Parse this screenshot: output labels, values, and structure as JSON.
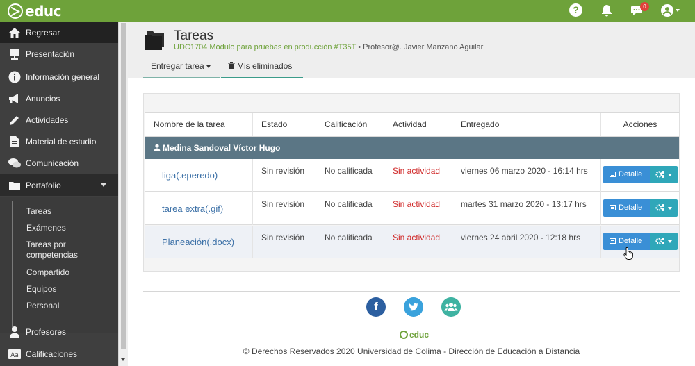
{
  "app": {
    "logo_text": "educ"
  },
  "topbar": {
    "help_label": "?",
    "notification_count": "0"
  },
  "sidebar": {
    "items": [
      {
        "label": "Regresar",
        "icon": "home-icon"
      },
      {
        "label": "Presentación",
        "icon": "presentation-icon"
      },
      {
        "label": "Información general",
        "icon": "info-icon"
      },
      {
        "label": "Anuncios",
        "icon": "megaphone-icon"
      },
      {
        "label": "Actividades",
        "icon": "pencil-icon"
      },
      {
        "label": "Material de estudio",
        "icon": "document-icon"
      },
      {
        "label": "Comunicación",
        "icon": "chat-icon"
      },
      {
        "label": "Portafolio",
        "icon": "folder-icon"
      },
      {
        "label": "Profesores",
        "icon": "user-icon"
      },
      {
        "label": "Calificaciones",
        "icon": "grades-icon"
      }
    ],
    "submenu": [
      "Tareas",
      "Exámenes",
      "Tareas por competencias",
      "Compartido",
      "Equipos",
      "Personal"
    ],
    "submenu_line2": "competencias"
  },
  "page": {
    "title": "Tareas",
    "course": "UDC1704 Módulo para pruebas en producción #T35T",
    "teacher": " • Profesor@. Javier Manzano Aguilar",
    "tabs": [
      "Entregar tarea",
      "Mis eliminados"
    ]
  },
  "table": {
    "headers": [
      "Nombre de la tarea",
      "Estado",
      "Calificación",
      "Actividad",
      "Entregado",
      "Acciones"
    ],
    "group": "Medina Sandoval Víctor Hugo",
    "rows": [
      {
        "name": "liga(.eperedo)",
        "estado": "Sin revisión",
        "calificacion": "No calificada",
        "actividad": "Sin actividad",
        "entregado": "viernes 06 marzo 2020 - 16:14 hrs"
      },
      {
        "name": "tarea extra(.gif)",
        "estado": "Sin revisión",
        "calificacion": "No calificada",
        "actividad": "Sin actividad",
        "entregado": "martes 31 marzo 2020 - 13:17 hrs"
      },
      {
        "name": "Planeación(.docx)",
        "estado": "Sin revisión",
        "calificacion": "No calificada",
        "actividad": "Sin actividad",
        "entregado": "viernes 24 abril 2020 - 12:18 hrs"
      }
    ],
    "detail_label": "Detalle"
  },
  "footer": {
    "logo_text": "educ",
    "copyright": "© Derechos Reservados 2020 Universidad de Colima - Dirección de Educación a Distancia"
  },
  "colors": {
    "brand_green": "#6ea23a",
    "sidebar": "#3f3f3f",
    "group_row": "#5b7685",
    "detail_button": "#3a8fd6",
    "gear_button": "#2fa7b9",
    "status_red": "#d02a2a"
  }
}
